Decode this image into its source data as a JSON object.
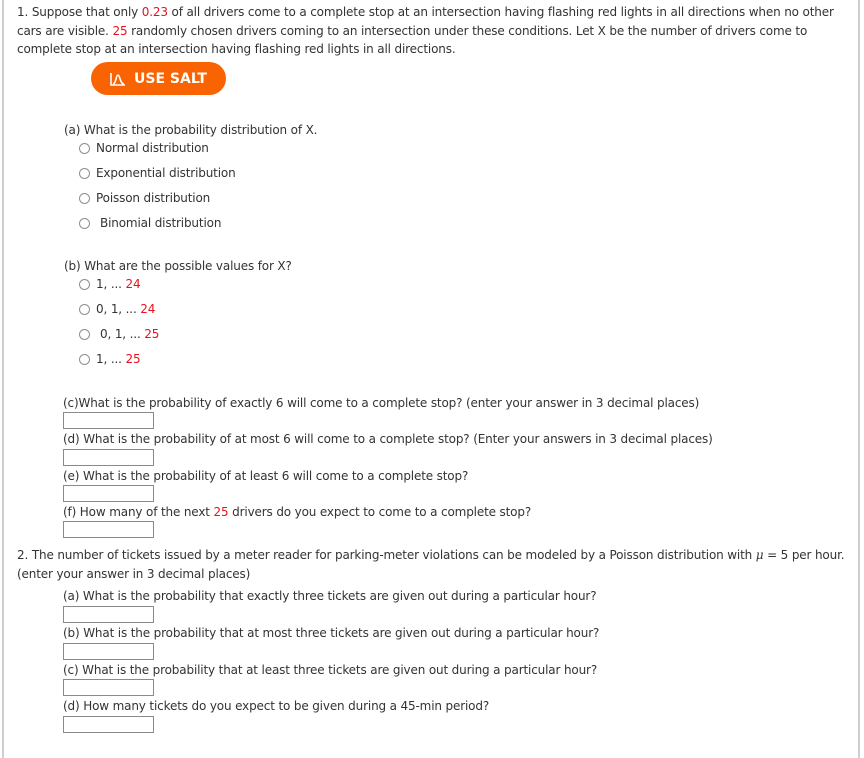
{
  "q1": {
    "intro_parts": [
      {
        "text": "1. Suppose that only ",
        "red": false
      },
      {
        "text": "0.23",
        "red": true
      },
      {
        "text": " of all drivers come to a complete stop at an intersection having flashing red lights in all directions when no other cars are visible. ",
        "red": false
      },
      {
        "text": "25",
        "red": true
      },
      {
        "text": " randomly chosen drivers coming to an intersection under these conditions. Let X be the number of drivers come to complete stop at an intersection having flashing red lights in all directions.",
        "red": false
      }
    ],
    "salt_button": {
      "label": "USE SALT",
      "icon": "salt-chart-icon",
      "color": "#f96302"
    },
    "part_a": {
      "question": "(a) What is the probability distribution of X.",
      "options": [
        "Normal distribution",
        "Exponential distribution",
        "Poisson distribution",
        "Binomial distribution"
      ]
    },
    "part_b": {
      "question": "(b) What are the possible values for X?",
      "options": [
        {
          "prefix": "1, ... ",
          "value": "24"
        },
        {
          "prefix": "0, 1, ... ",
          "value": "24"
        },
        {
          "prefix": "0, 1, ... ",
          "value": "25"
        },
        {
          "prefix": "1, ... ",
          "value": "25"
        }
      ]
    },
    "part_c": {
      "question": "(c)What is the probability of exactly 6 will come to a complete stop? (enter your answer in 3 decimal places)",
      "answer": ""
    },
    "part_d": {
      "question": "(d) What is the probability of at most 6 will come to a complete stop? (Enter your answers in 3 decimal places)",
      "answer": ""
    },
    "part_e": {
      "question": "(e) What is the probability of at least 6 will come to a complete stop?",
      "answer": ""
    },
    "part_f": {
      "question_before": "(f) How many of the next ",
      "question_value": "25",
      "question_after": " drivers do you expect to come to a complete stop?",
      "answer": ""
    }
  },
  "q2": {
    "intro_before": "2. The number of tickets issued by a meter reader for parking-meter violations can be modeled by a Poisson distribution with ",
    "mu_symbol": "μ",
    "intro_after": " = 5 per hour.",
    "intro_line2": "(enter your answer in 3 decimal places)",
    "part_a": {
      "question": "(a) What is the probability that exactly three tickets are given out during a particular hour?",
      "answer": ""
    },
    "part_b": {
      "question": "(b) What is the probability that at most three tickets are given out during a particular hour?",
      "answer": ""
    },
    "part_c": {
      "question": "(c) What is the probability that at least three tickets are given out during a particular hour?",
      "answer": ""
    },
    "part_d": {
      "question": "(d) How many tickets do you expect to be given during a 45-min period?",
      "answer": ""
    }
  },
  "colors": {
    "accent_red": "#e8121e",
    "salt_orange": "#f96302",
    "text": "#333333"
  }
}
